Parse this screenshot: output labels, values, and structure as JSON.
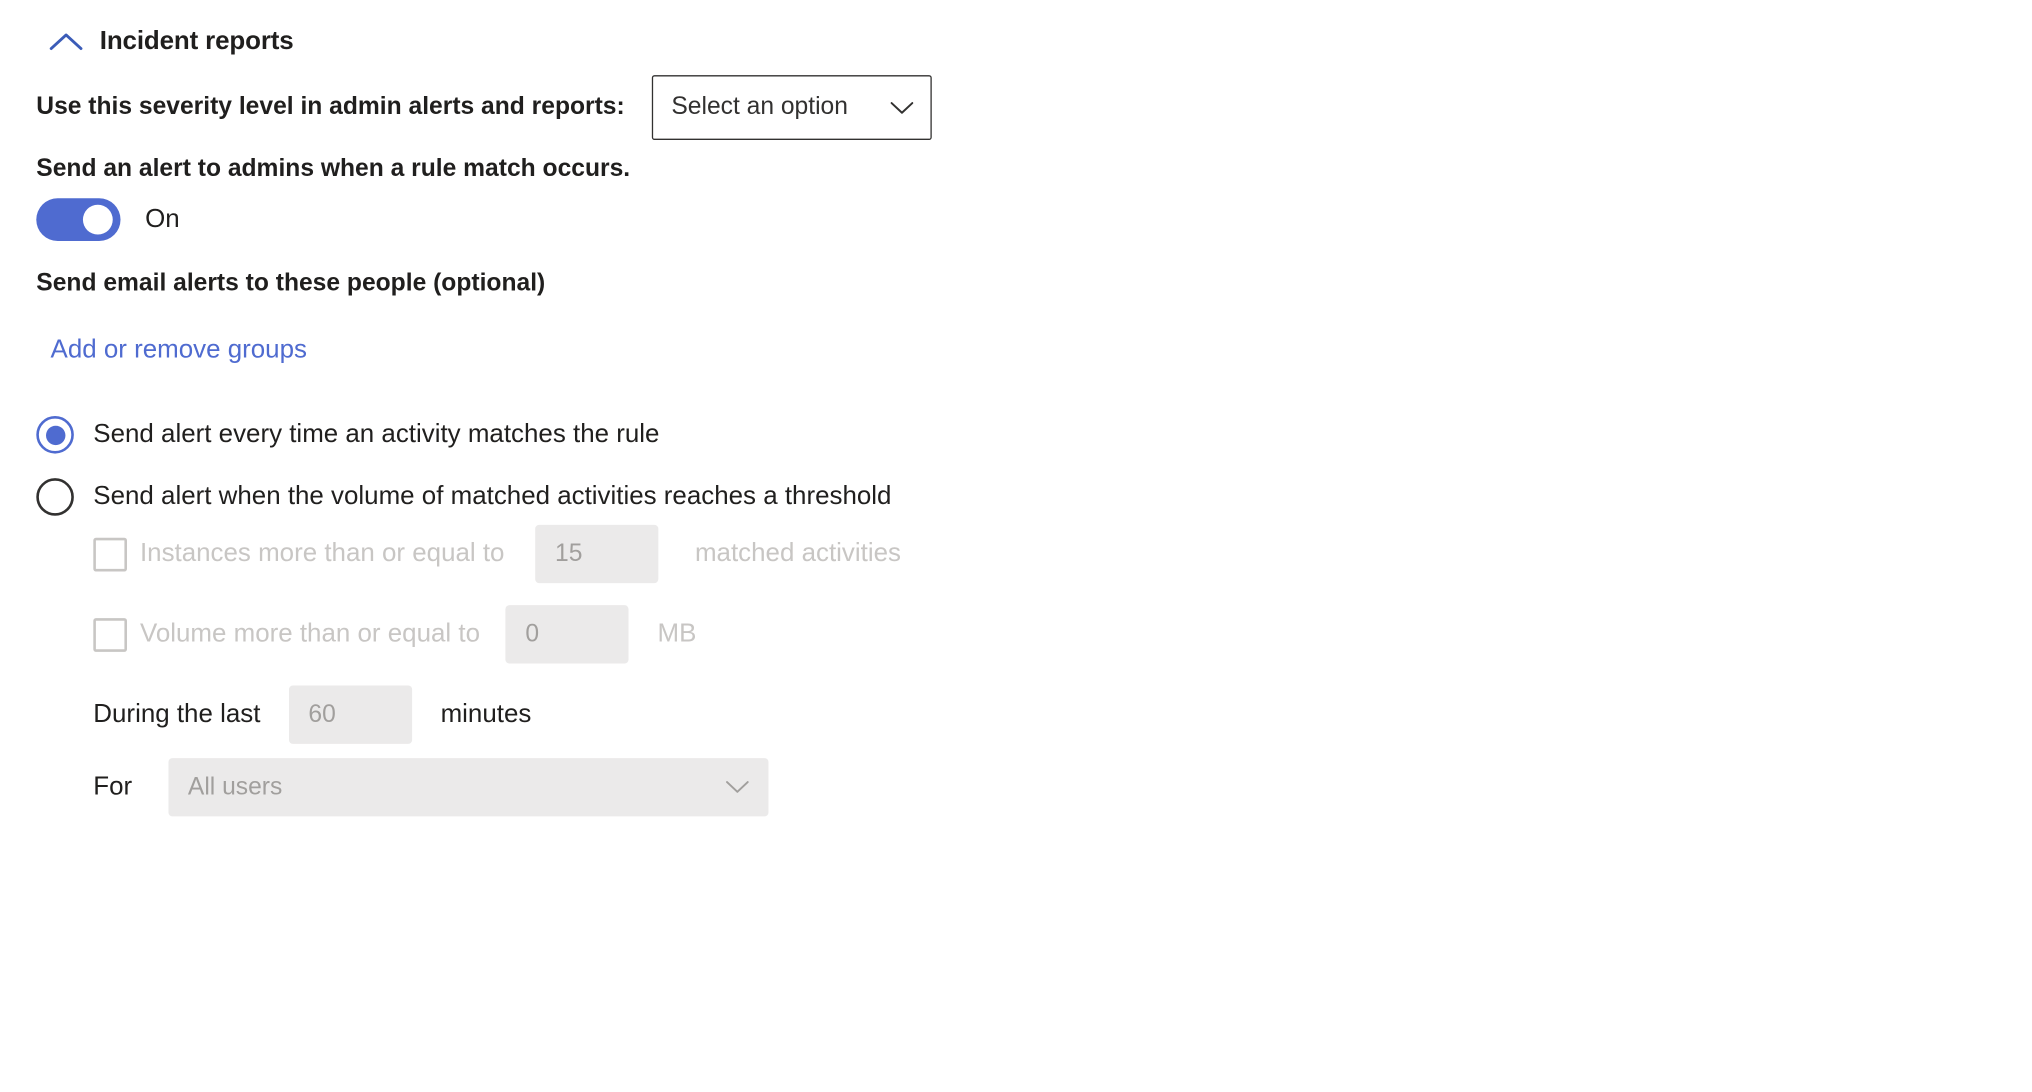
{
  "section": {
    "collapse_icon": "chevron-up-icon",
    "title": "Incident reports"
  },
  "severity": {
    "label": "Use this severity level in admin alerts and reports:",
    "dropdown_value": "Select an option",
    "dropdown_icon": "chevron-down-icon"
  },
  "admin_alert": {
    "label": "Send an alert to admins when a rule match occurs.",
    "toggle_state": "On",
    "toggle_on_color": "#4f6bd0"
  },
  "email_alerts": {
    "label": "Send email alerts to these people (optional)",
    "link_text": "Add or remove groups",
    "link_color": "#4f6bd0"
  },
  "alert_mode": {
    "options": [
      {
        "label": "Send alert every time an activity matches the rule",
        "selected": true
      },
      {
        "label": "Send alert when the volume of matched activities reaches a threshold",
        "selected": false
      }
    ]
  },
  "threshold": {
    "instances": {
      "checkbox_label": "Instances more than or equal to",
      "value": "15",
      "suffix": "matched activities",
      "checked": false,
      "disabled": true
    },
    "volume": {
      "checkbox_label": "Volume more than or equal to",
      "value": "0",
      "suffix": "MB",
      "checked": false,
      "disabled": true
    },
    "duration": {
      "prefix": "During the last",
      "value": "60",
      "suffix": "minutes"
    },
    "scope": {
      "prefix": "For",
      "value": "All users",
      "icon": "chevron-down-icon"
    }
  }
}
